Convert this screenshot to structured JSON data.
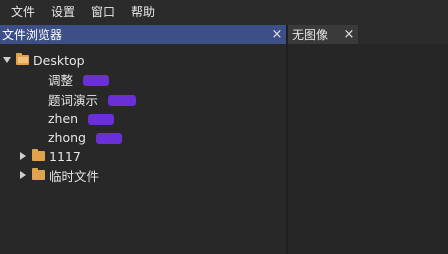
{
  "menubar": {
    "items": [
      "文件",
      "设置",
      "窗口",
      "帮助"
    ]
  },
  "left_panel": {
    "title": "文件浏览器",
    "close": "×"
  },
  "right_panel": {
    "tab_title": "无图像",
    "close": "×"
  },
  "tree": {
    "root": "Desktop",
    "children": [
      "调整",
      "题词演示",
      "zhen",
      "zhong"
    ],
    "folders": [
      "1117",
      "临时文件"
    ]
  }
}
